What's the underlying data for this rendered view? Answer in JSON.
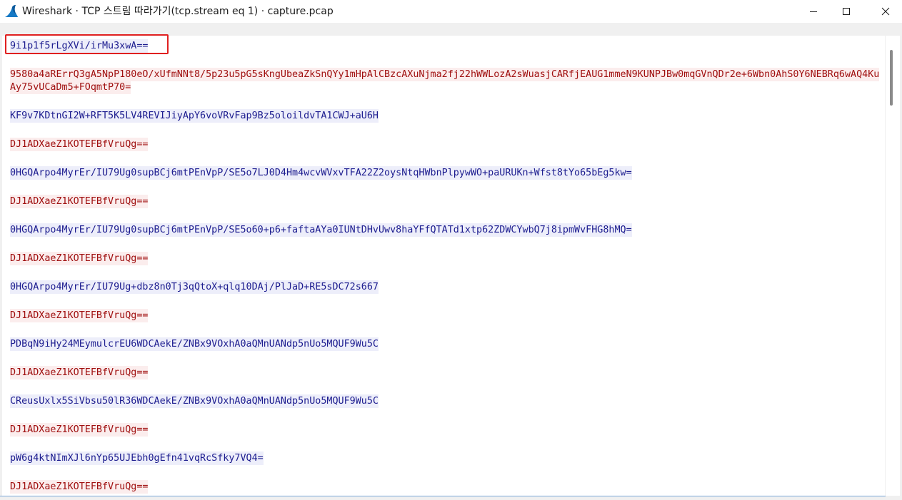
{
  "window": {
    "title": "Wireshark · TCP 스트림 따라가기(tcp.stream eq 1) · capture.pcap",
    "icon": "wireshark-fin-icon",
    "controls": [
      "minimize-icon",
      "maximize-icon",
      "close-icon"
    ]
  },
  "colors": {
    "client_text": "#1c1c8f",
    "client_bg": "#edeefa",
    "server_text": "#a01010",
    "server_bg": "#fbeded",
    "highlight_border": "#e02020"
  },
  "stream": [
    {
      "dir": "client",
      "text": "9i1p1f5rLgXVi/irMu3xwA=="
    },
    {
      "dir": "server",
      "text": "9580a4aRErrQ3gA5NpP180eO/xUfmNNt8/5p23u5pG5sKngUbeaZkSnQYy1mHpAlCBzcAXuNjma2fj22hWWLozA2sWuasjCARfjEAUG1mmeN9KUNPJBw0mqGVnQDr2e+6Wbn0AhS0Y6NEBRq6wAQ4KuAy75vUCaDm5+FOqmtP70="
    },
    {
      "dir": "client",
      "text": "KF9v7KDtnGI2W+RFT5K5LV4REVIJiyApY6voVRvFap9Bz5oloildvTA1CWJ+aU6H"
    },
    {
      "dir": "server",
      "text": "DJ1ADXaeZ1KOTEFBfVruQg=="
    },
    {
      "dir": "client",
      "text": "0HGQArpo4MyrEr/IU79Ug0supBCj6mtPEnVpP/SE5o7LJ0D4Hm4wcvWVxvTFA22Z2oysNtqHWbnPlpywWO+paURUKn+Wfst8tYo65bEg5kw="
    },
    {
      "dir": "server",
      "text": "DJ1ADXaeZ1KOTEFBfVruQg=="
    },
    {
      "dir": "client",
      "text": "0HGQArpo4MyrEr/IU79Ug0supBCj6mtPEnVpP/SE5o60+p6+faftaAYa0IUNtDHvUwv8haYFfQTATd1xtp62ZDWCYwbQ7j8ipmWvFHG8hMQ="
    },
    {
      "dir": "server",
      "text": "DJ1ADXaeZ1KOTEFBfVruQg=="
    },
    {
      "dir": "client",
      "text": "0HGQArpo4MyrEr/IU79Ug+dbz8n0Tj3qQtoX+qlq10DAj/PlJaD+RE5sDC72s667"
    },
    {
      "dir": "server",
      "text": "DJ1ADXaeZ1KOTEFBfVruQg=="
    },
    {
      "dir": "client",
      "text": "PDBqN9iHy24MEymulcrEU6WDCAekE/ZNBx9VOxhA0aQMnUANdp5nUo5MQUF9Wu5C"
    },
    {
      "dir": "server",
      "text": "DJ1ADXaeZ1KOTEFBfVruQg=="
    },
    {
      "dir": "client",
      "text": "CReusUxlx5SiVbsu50lR36WDCAekE/ZNBx9VOxhA0aQMnUANdp5nUo5MQUF9Wu5C"
    },
    {
      "dir": "server",
      "text": "DJ1ADXaeZ1KOTEFBfVruQg=="
    },
    {
      "dir": "client",
      "text": "pW6g4ktNImXJl6nYp65UJEbh0gEfn41vqRcSfky7VQ4="
    },
    {
      "dir": "server",
      "text": "DJ1ADXaeZ1KOTEFBfVruQg=="
    }
  ]
}
